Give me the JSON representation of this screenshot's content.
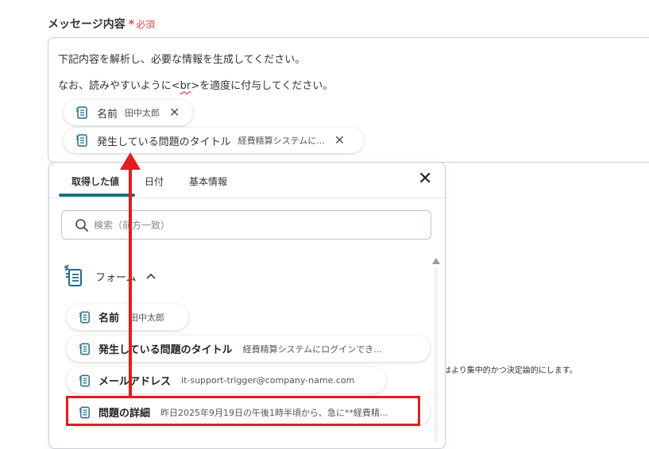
{
  "field": {
    "label": "メッセージ内容",
    "required_star": "*",
    "required_text": "必須"
  },
  "message": {
    "line1": "下記内容を解析し、必要な情報を生成してください。",
    "line2_before": "なお、読みやすいように<",
    "line2_tag": "br",
    "line2_after": ">を適度に付与してください。",
    "chips": [
      {
        "name": "名前",
        "value": "田中太郎",
        "remove": "✕"
      },
      {
        "name": "発生している問題のタイトル",
        "value": "経費精算システムに...",
        "remove": "✕"
      }
    ]
  },
  "popover": {
    "tabs": [
      {
        "label": "取得した値",
        "active": true
      },
      {
        "label": "日付",
        "active": false
      },
      {
        "label": "基本情報",
        "active": false
      }
    ],
    "close": "✕",
    "search_placeholder": "検索（前方一致）",
    "group": {
      "name": "フォーム",
      "icon": "form-icon",
      "expanded": true
    },
    "items": [
      {
        "name": "名前",
        "value": "田中太郎"
      },
      {
        "name": "発生している問題のタイトル",
        "value": "経費精算システムにログインでき..."
      },
      {
        "name": "メールアドレス",
        "value": "it-support-trigger@company-name.com"
      },
      {
        "name": "問題の詳細",
        "value": "昨日2025年9月19日の午後1時半頃から、急に**経費精..."
      }
    ]
  },
  "background_fragment": "はより集中的かつ決定論的にします。",
  "colors": {
    "accent_tab": "#1d6d82",
    "required": "#e5484d",
    "annotation_red": "#e11d1d"
  }
}
